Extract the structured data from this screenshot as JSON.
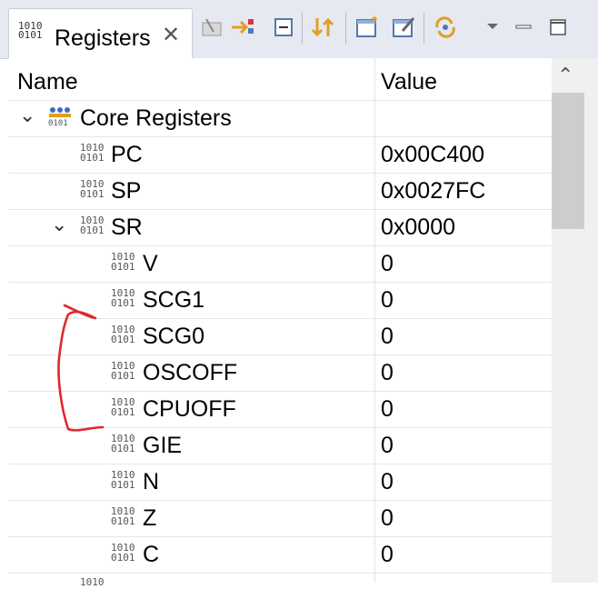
{
  "tab": {
    "title": "Registers",
    "icon_text": "1010\n0101"
  },
  "toolbar": {
    "icons": [
      "clear-icon",
      "import-icon",
      "collapse-icon",
      "sync-icon",
      "new-group-icon",
      "edit-group-icon",
      "refresh-icon",
      "view-menu-icon",
      "minimize-icon",
      "maximize-icon"
    ]
  },
  "table": {
    "columns": {
      "name": "Name",
      "value": "Value"
    },
    "group": "Core Registers",
    "rows": [
      {
        "name": "PC",
        "value": "0x00C400"
      },
      {
        "name": "SP",
        "value": "0x0027FC"
      },
      {
        "name": "SR",
        "value": "0x0000"
      },
      {
        "name": "V",
        "value": "0"
      },
      {
        "name": "SCG1",
        "value": "0"
      },
      {
        "name": "SCG0",
        "value": "0"
      },
      {
        "name": "OSCOFF",
        "value": "0"
      },
      {
        "name": "CPUOFF",
        "value": "0"
      },
      {
        "name": "GIE",
        "value": "0"
      },
      {
        "name": "N",
        "value": "0"
      },
      {
        "name": "Z",
        "value": "0"
      },
      {
        "name": "C",
        "value": "0"
      }
    ]
  },
  "colors": {
    "annotation": "#e0282e",
    "toolbar_bg": "#e6e9f2",
    "scroll_thumb": "#cdcdcd"
  }
}
